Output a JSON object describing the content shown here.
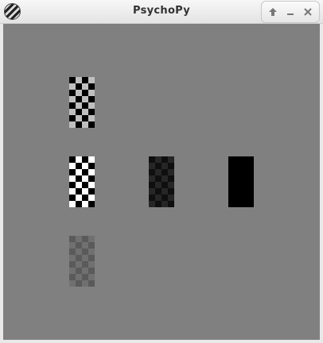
{
  "window": {
    "title": "PsychoPy"
  },
  "titlebar_icons": {
    "app": "psychopy-logo-icon",
    "maximize": "arrow-up-icon",
    "minimize": "minimize-icon",
    "close": "close-icon"
  },
  "colors": {
    "canvas_background": "#808080"
  },
  "stimuli": [
    {
      "name": "checkerboard-top-left",
      "dark": "#000000",
      "light": "#bfbfbf"
    },
    {
      "name": "checkerboard-middle-left",
      "dark": "#000000",
      "light": "#ffffff"
    },
    {
      "name": "checkerboard-middle-center",
      "dark": "#0f0f0f",
      "light": "#262626"
    },
    {
      "name": "checkerboard-middle-right",
      "dark": "#000000",
      "light": "#000000"
    },
    {
      "name": "checkerboard-bottom-left",
      "dark": "#5a5a5a",
      "light": "#707070"
    }
  ]
}
